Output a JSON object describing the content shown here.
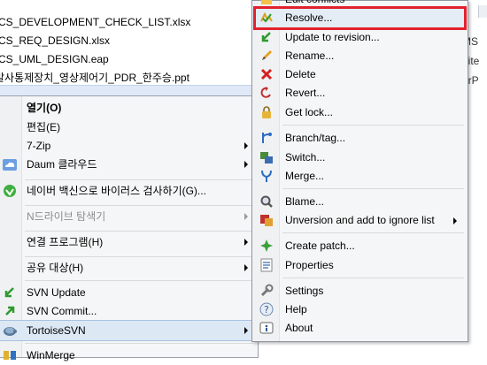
{
  "explorer": {
    "files": [
      "CS_DEVELOPMENT_CHECK_LIST.xlsx",
      "CS_REQ_DESIGN.xlsx",
      "CS_UML_DESIGN.eap",
      "발사통제장치_영상제어기_PDR_한주승.ppt"
    ],
    "right_edge": [
      "MS",
      "hite",
      "erP"
    ]
  },
  "context_menu": {
    "items": [
      {
        "label": "열기(O)",
        "bold": true
      },
      {
        "label": "편집(E)"
      },
      {
        "label": "7-Zip",
        "submenu": true
      },
      {
        "label": "Daum 클라우드",
        "submenu": true,
        "icon": "cloud-icon"
      },
      {
        "label": "네이버 백신으로 바이러스 검사하기(G)...",
        "icon": "shield-icon"
      },
      {
        "label": "N드라이브 탐색기",
        "submenu": true,
        "disabled": true
      },
      {
        "label": "연결 프로그램(H)",
        "submenu": true
      },
      {
        "label": "공유 대상(H)",
        "submenu": true
      },
      {
        "label": "SVN Update",
        "icon": "svn-update-icon"
      },
      {
        "label": "SVN Commit...",
        "icon": "svn-commit-icon"
      },
      {
        "label": "TortoiseSVN",
        "submenu": true,
        "icon": "tortoise-icon"
      },
      {
        "label": "WinMerge",
        "icon": "winmerge-icon"
      }
    ]
  },
  "submenu": {
    "items": [
      {
        "label": "Edit conflicts",
        "icon": "edit-conflicts-icon"
      },
      {
        "label": "Resolve...",
        "icon": "resolve-icon"
      },
      {
        "label": "Update to revision...",
        "icon": "update-revision-icon"
      },
      {
        "label": "Rename...",
        "icon": "pencil-icon"
      },
      {
        "label": "Delete",
        "icon": "delete-icon"
      },
      {
        "label": "Revert...",
        "icon": "revert-icon"
      },
      {
        "label": "Get lock...",
        "icon": "lock-icon"
      },
      {
        "label": "Branch/tag...",
        "icon": "branch-icon"
      },
      {
        "label": "Switch...",
        "icon": "switch-icon"
      },
      {
        "label": "Merge...",
        "icon": "merge-icon"
      },
      {
        "label": "Blame...",
        "icon": "blame-icon"
      },
      {
        "label": "Unversion and add to ignore list",
        "icon": "ignore-icon",
        "submenu": true
      },
      {
        "label": "Create patch...",
        "icon": "patch-icon"
      },
      {
        "label": "Properties",
        "icon": "properties-icon"
      },
      {
        "label": "Settings",
        "icon": "settings-icon"
      },
      {
        "label": "Help",
        "icon": "help-icon"
      },
      {
        "label": "About",
        "icon": "about-icon"
      }
    ]
  },
  "colors": {
    "highlight_box": "#e2212e",
    "selection": "#dde8f5"
  }
}
